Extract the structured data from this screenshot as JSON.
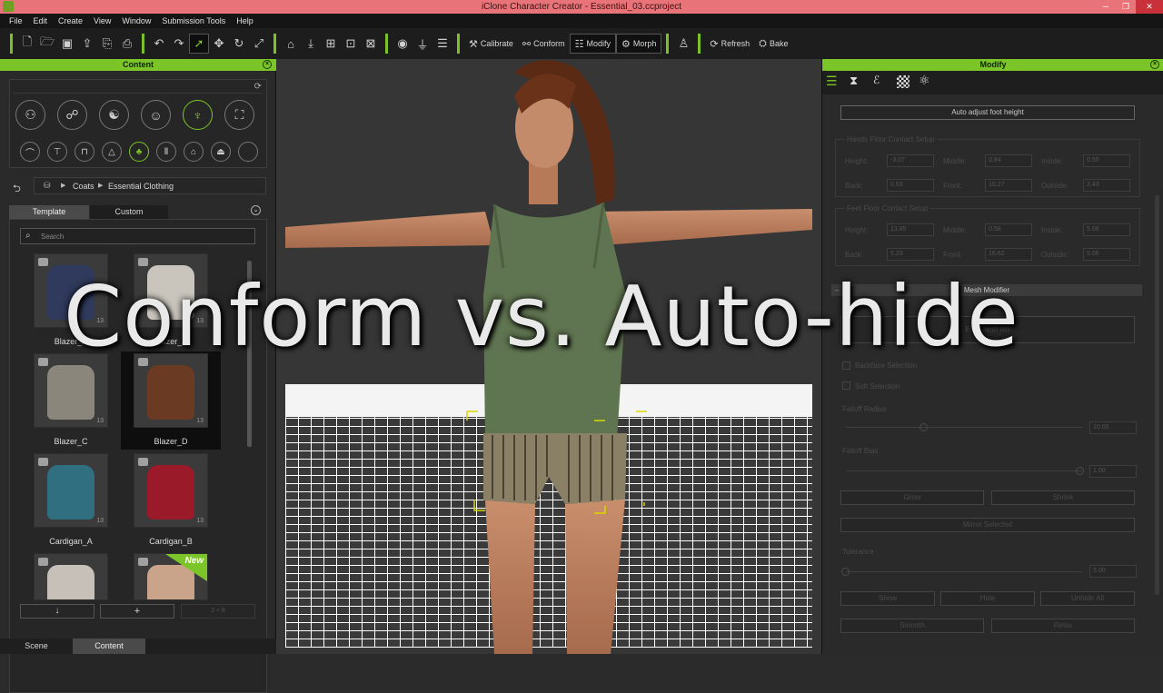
{
  "window": {
    "title": "iClone Character Creator - Essential_03.ccproject",
    "min": "─",
    "max": "❐",
    "close": "✕"
  },
  "menu": [
    "File",
    "Edit",
    "Create",
    "View",
    "Window",
    "Submission Tools",
    "Help"
  ],
  "toolbar": {
    "calibrate": "Calibrate",
    "conform": "Conform",
    "modify": "Modify",
    "morph": "Morph",
    "refresh": "Refresh",
    "bake": "Bake"
  },
  "content_panel": {
    "title": "Content",
    "breadcrumb": [
      "Coats",
      "Essential Clothing"
    ],
    "tabs": [
      "Template",
      "Custom"
    ],
    "search_placeholder": "Search",
    "items": [
      {
        "label": "Blazer_A",
        "count": "13",
        "color": "#2f3a5c"
      },
      {
        "label": "Blazer_B",
        "count": "13",
        "color": "#c9c5bd"
      },
      {
        "label": "Blazer_C",
        "count": "13",
        "color": "#8a867c"
      },
      {
        "label": "Blazer_D",
        "count": "13",
        "color": "#6a3a22"
      },
      {
        "label": "Cardigan_A",
        "count": "13",
        "color": "#2f6f80"
      },
      {
        "label": "Cardigan_B",
        "count": "13",
        "color": "#9a1a2a"
      },
      {
        "label": "",
        "count": "",
        "color": "#c7c0b8"
      },
      {
        "label": "",
        "count": "",
        "color": "#c9a48a",
        "badge": "New"
      }
    ],
    "bottom_buttons": [
      "↓",
      "+",
      "2 ÷ 8"
    ]
  },
  "bottom_tabs": [
    "Scene",
    "Content"
  ],
  "modify_panel": {
    "title": "Modify",
    "auto_adjust": "Auto adjust foot height",
    "hands_group": "Hands Floor Contact Setup",
    "feet_group": "Feet Floor Contact Setup",
    "hands": {
      "height": "-3.07",
      "middle": "0.84",
      "inside": "0.55",
      "back": "0.03",
      "front": "10.27",
      "outside": "2.43"
    },
    "feet": {
      "height": "13.85",
      "middle": "0.58",
      "inside": "5.06",
      "back": "5.23",
      "front": "16.62",
      "outside": "5.06"
    },
    "labels": {
      "height": "Height:",
      "middle": "Middle:",
      "inside": "Inside:",
      "back": "Back:",
      "front": "Front:",
      "outside": "Outside:"
    },
    "mesh_modifier": "Mesh Modifier",
    "edit_mesh": "Edit Mesh Mo",
    "backface": "Backface Selection",
    "soft": "Soft Selection",
    "falloff_radius": "Falloff Radius",
    "falloff_radius_val": "10.00",
    "falloff_bias": "Falloff Bias",
    "falloff_bias_val": "1.00",
    "grow": "Grow",
    "shrink": "Shrink",
    "mirror": "Mirror Selected",
    "tolerance": "Tolerance",
    "tolerance_val": "5.00",
    "show": "Show",
    "hide": "Hide",
    "unhide": "Unhide All",
    "smooth": "Smooth",
    "relax": "Relax"
  },
  "overlay": "Conform vs. Auto-hide"
}
